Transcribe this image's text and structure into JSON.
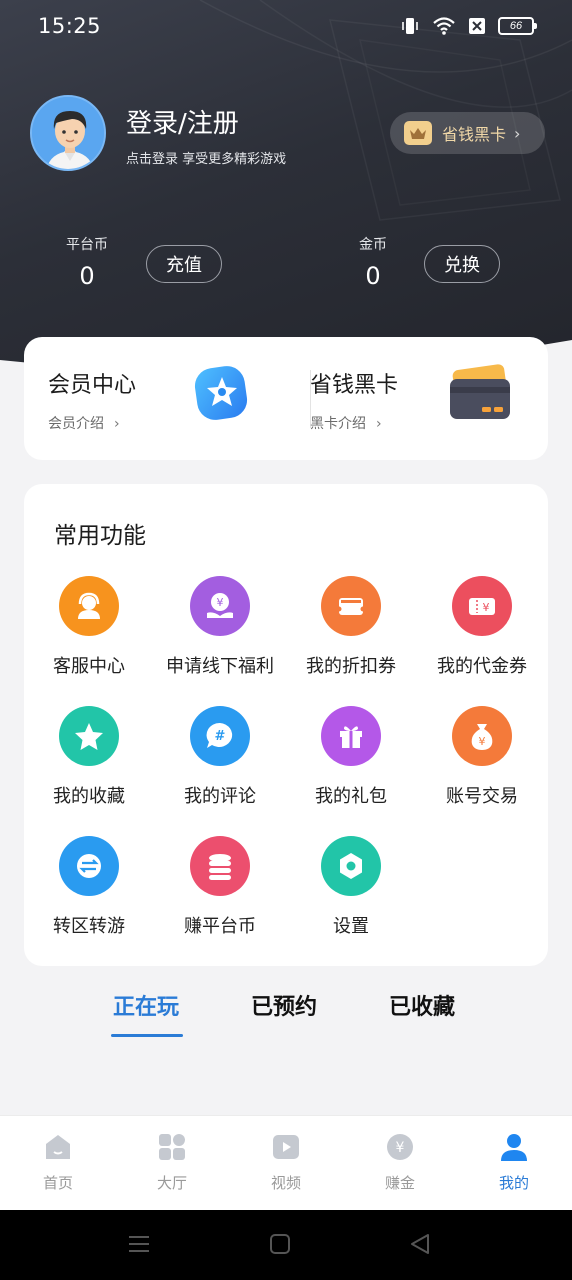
{
  "status_bar": {
    "time": "15:25",
    "battery": "66"
  },
  "profile": {
    "title": "登录/注册",
    "subtitle": "点击登录 享受更多精彩游戏"
  },
  "vip_pill": {
    "label": "省钱黑卡",
    "chevron": "›"
  },
  "currencies": [
    {
      "label": "平台币",
      "value": "0",
      "button": "充值"
    },
    {
      "label": "金币",
      "value": "0",
      "button": "兑换"
    }
  ],
  "member_card": {
    "left": {
      "title": "会员中心",
      "sub": "会员介绍",
      "chevron": "›"
    },
    "right": {
      "title": "省钱黑卡",
      "sub": "黑卡介绍",
      "chevron": "›"
    }
  },
  "functions": {
    "title": "常用功能",
    "items": [
      {
        "label": "客服中心",
        "icon": "customer-service-icon",
        "color": "#f7931e"
      },
      {
        "label": "申请线下福利",
        "icon": "welfare-icon",
        "color": "#a35ee0"
      },
      {
        "label": "我的折扣券",
        "icon": "discount-coupon-icon",
        "color": "#f47a3a"
      },
      {
        "label": "我的代金券",
        "icon": "voucher-icon",
        "color": "#ec4f5e"
      },
      {
        "label": "我的收藏",
        "icon": "star-icon",
        "color": "#22c5a8"
      },
      {
        "label": "我的评论",
        "icon": "comment-icon",
        "color": "#2a9bf0"
      },
      {
        "label": "我的礼包",
        "icon": "gift-icon",
        "color": "#b458e8"
      },
      {
        "label": "账号交易",
        "icon": "money-bag-icon",
        "color": "#f47a3a"
      },
      {
        "label": "转区转游",
        "icon": "transfer-icon",
        "color": "#2a9bf0"
      },
      {
        "label": "赚平台币",
        "icon": "coin-stack-icon",
        "color": "#ec4f6e"
      },
      {
        "label": "设置",
        "icon": "settings-icon",
        "color": "#22c5a8"
      }
    ]
  },
  "tabs": [
    {
      "label": "正在玩",
      "active": true
    },
    {
      "label": "已预约",
      "active": false
    },
    {
      "label": "已收藏",
      "active": false
    }
  ],
  "bottom_nav": [
    {
      "label": "首页",
      "icon": "home-icon"
    },
    {
      "label": "大厅",
      "icon": "grid-icon"
    },
    {
      "label": "视频",
      "icon": "video-icon"
    },
    {
      "label": "赚金",
      "icon": "yen-coin-icon"
    },
    {
      "label": "我的",
      "icon": "user-icon",
      "active": true
    }
  ],
  "colors": {
    "accent": "#2a7bd6",
    "header_dark": "#2c2f38"
  }
}
